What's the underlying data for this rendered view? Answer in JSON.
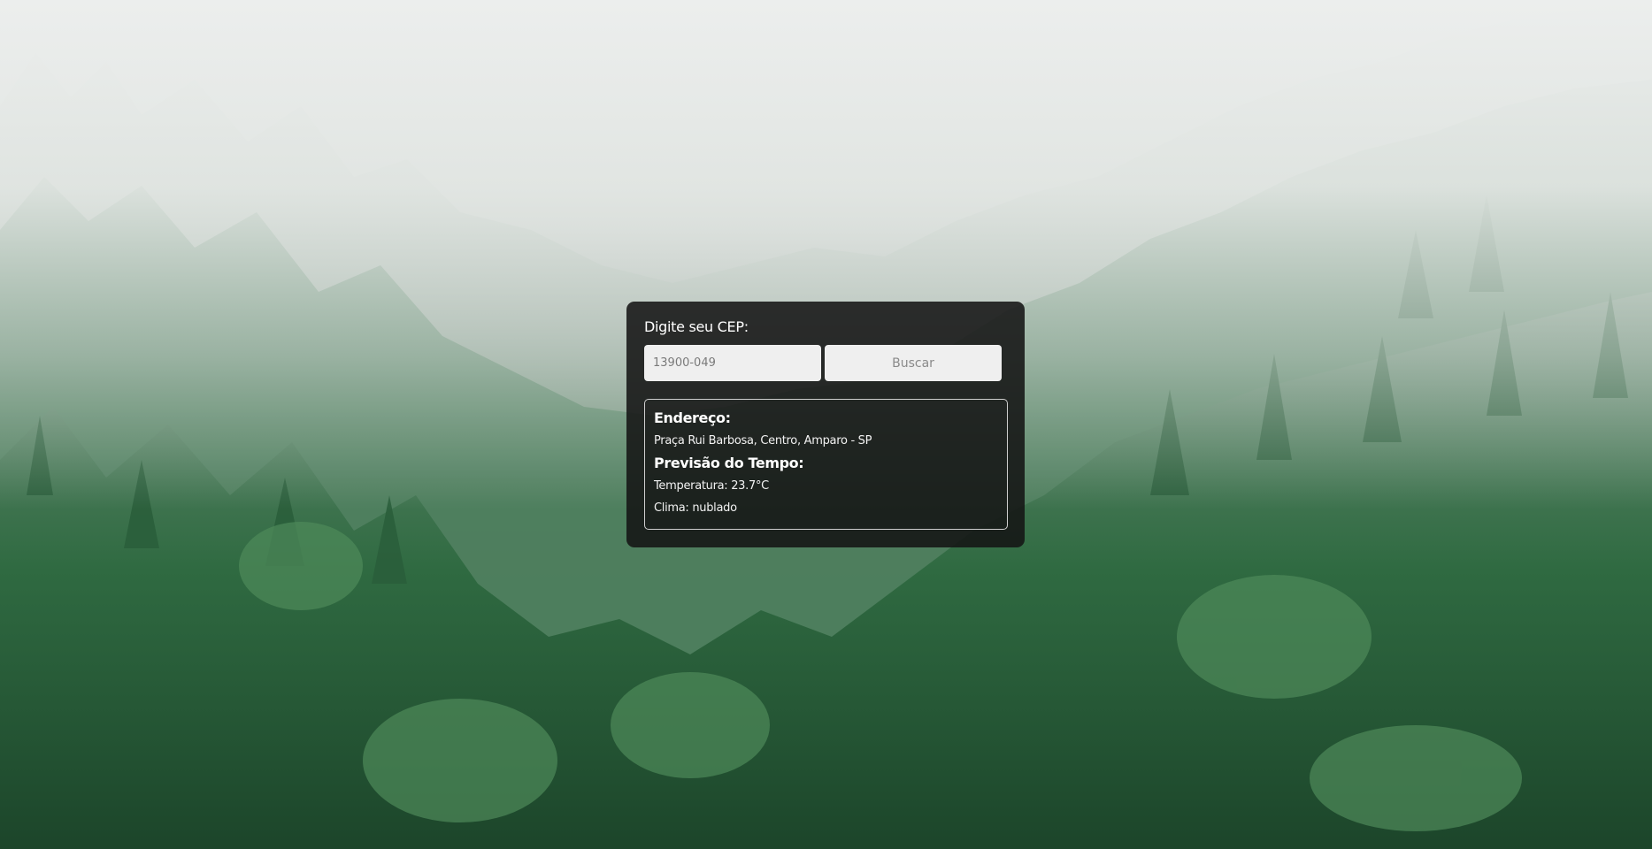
{
  "background": {
    "description_icon": "forest-fog-background",
    "sky_color": "#e6e9e7",
    "forest_dark": "#1f4a2d",
    "forest_light": "#4f8a5a"
  },
  "form": {
    "label": "Digite seu CEP:",
    "cep_value": "13900-049",
    "button_label": "Buscar"
  },
  "results": {
    "address_heading": "Endereço:",
    "address_line": "Praça Rui Barbosa, Centro, Amparo - SP",
    "weather_heading": "Previsão do Tempo:",
    "temperature_line": "Temperatura: 23.7°C",
    "climate_line": "Clima: nublado"
  }
}
